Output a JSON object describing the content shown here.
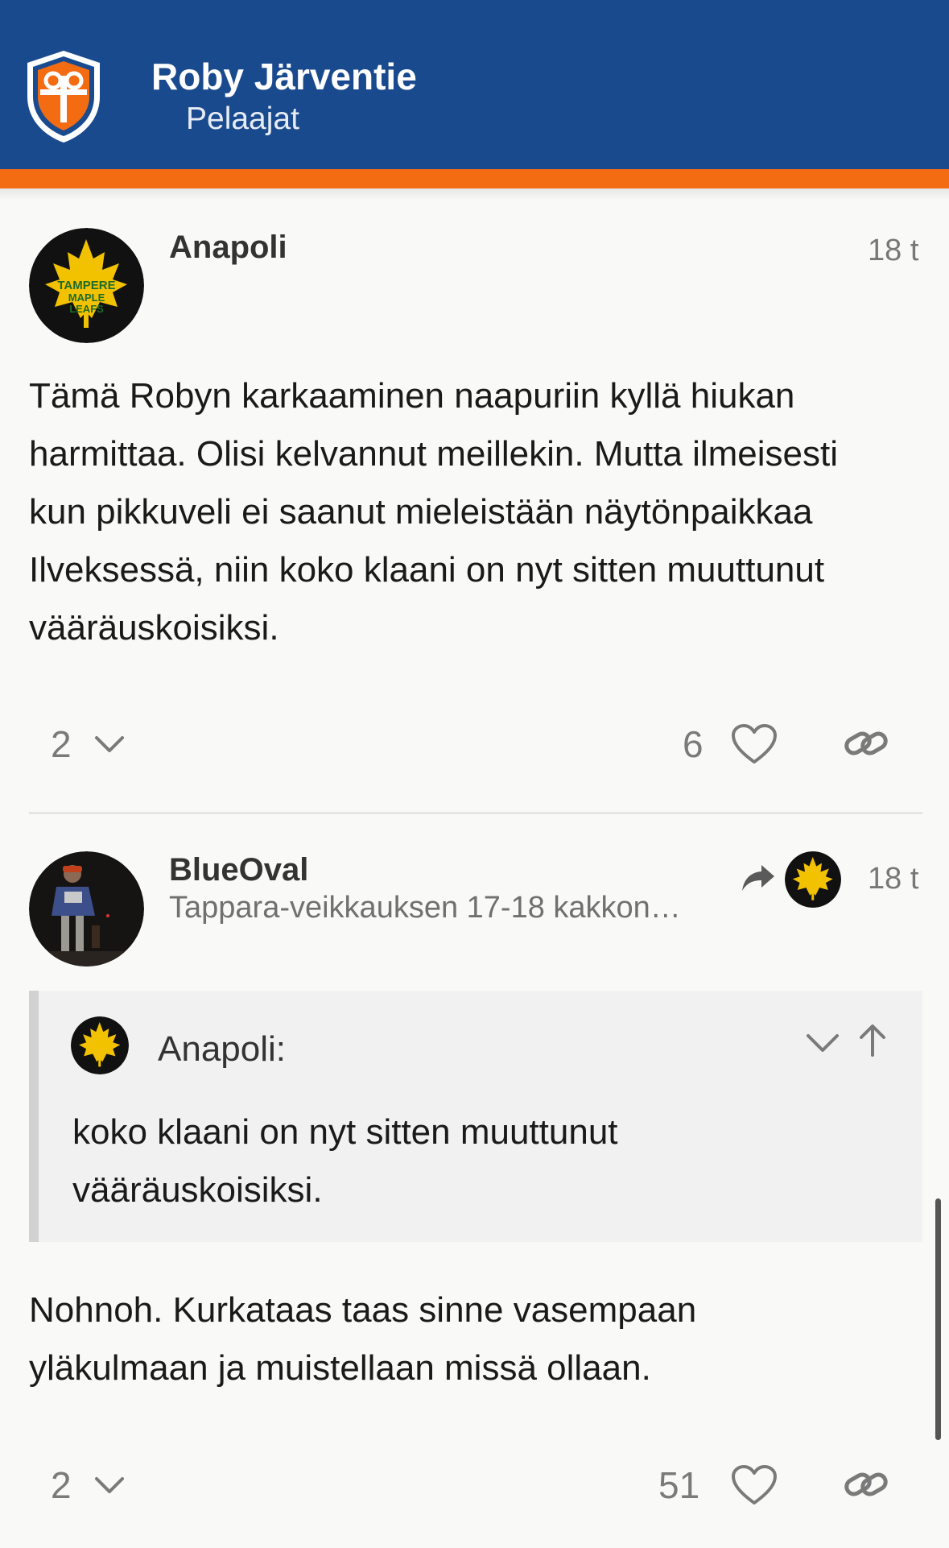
{
  "header": {
    "topic_title": "Roby Järventie",
    "category": "Pelaajat",
    "logo_icon": "tappara-shield-logo",
    "colors": {
      "header_bg": "#1a4a8e",
      "stripe": "#f36c12"
    }
  },
  "posts": [
    {
      "username": "Anapoli",
      "date": "18 t",
      "avatar_icon": "tampere-maple-leafs-avatar",
      "avatar_text": [
        "TAMPERE",
        "MAPLE",
        "LEAFS"
      ],
      "body": [
        "Tämä Robyn karkaaminen naapuriin kyllä hiukan",
        "harmittaa. Olisi kelvannut meillekin. Mutta ilmeisesti",
        "kun pikkuveli ei saanut mieleistään näytönpaikkaa",
        "Ilveksessä, niin koko klaani on nyt sitten muuttunut",
        "vääräuskoisiksi."
      ],
      "replies_count": "2",
      "likes_count": "6"
    },
    {
      "username": "BlueOval",
      "user_title": "Tappara-veikkauksen 17-18 kakkon…",
      "date": "18 t",
      "avatar_icon": "blueoval-user-avatar",
      "reply_to_icon": "share-arrow-icon",
      "quote": {
        "username": "Anapoli:",
        "lines": [
          "koko klaani on nyt sitten muuttunut",
          "vääräuskoisiksi."
        ]
      },
      "body": [
        "Nohnoh. Kurkataas taas sinne vasempaan",
        "yläkulmaan ja muistellaan missä ollaan."
      ],
      "replies_count": "2",
      "likes_count": "51"
    }
  ]
}
